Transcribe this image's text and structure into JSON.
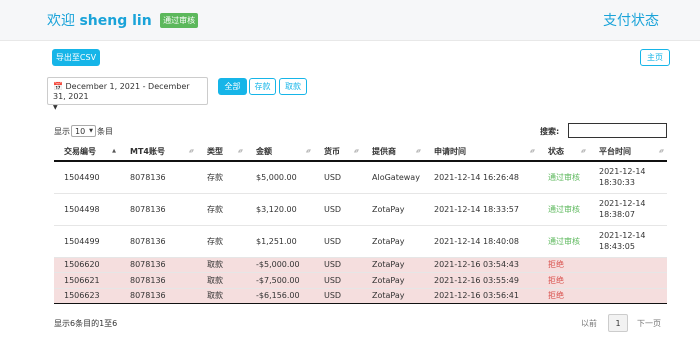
{
  "header": {
    "welcome": "欢迎",
    "username": "sheng lin",
    "verified_badge": "通过审核",
    "page_title": "支付状态"
  },
  "toolbar": {
    "export_label": "导出至CSV",
    "home_label": "主页"
  },
  "filters": {
    "date_range": "December 1, 2021 - December 31, 2021",
    "all_label": "全部",
    "deposit_label": "存款",
    "withdraw_label": "取款"
  },
  "table_controls": {
    "show_prefix": "显示",
    "page_size": "10",
    "show_suffix": "条目",
    "search_label": "搜索:",
    "search_value": ""
  },
  "table": {
    "columns": [
      "交易编号",
      "MT4账号",
      "类型",
      "金额",
      "货币",
      "提供商",
      "申请时间",
      "状态",
      "平台时间"
    ],
    "rows": [
      {
        "id": "1504490",
        "account": "8078136",
        "type": "存款",
        "amount": "$5,000.00",
        "currency": "USD",
        "provider": "AloGateway",
        "request_time": "2021-12-14 16:26:48",
        "status": "通过审核",
        "platform_date": "2021-12-14",
        "platform_time": "18:30:33"
      },
      {
        "id": "1504498",
        "account": "8078136",
        "type": "存款",
        "amount": "$3,120.00",
        "currency": "USD",
        "provider": "ZotaPay",
        "request_time": "2021-12-14 18:33:57",
        "status": "通过审核",
        "platform_date": "2021-12-14",
        "platform_time": "18:38:07"
      },
      {
        "id": "1504499",
        "account": "8078136",
        "type": "存款",
        "amount": "$1,251.00",
        "currency": "USD",
        "provider": "ZotaPay",
        "request_time": "2021-12-14 18:40:08",
        "status": "通过审核",
        "platform_date": "2021-12-14",
        "platform_time": "18:43:05"
      },
      {
        "id": "1506620",
        "account": "8078136",
        "type": "取款",
        "amount": "-$5,000.00",
        "currency": "USD",
        "provider": "ZotaPay",
        "request_time": "2021-12-16 03:54:43",
        "status": "拒绝",
        "platform_date": "",
        "platform_time": ""
      },
      {
        "id": "1506621",
        "account": "8078136",
        "type": "取款",
        "amount": "-$7,500.00",
        "currency": "USD",
        "provider": "ZotaPay",
        "request_time": "2021-12-16 03:55:49",
        "status": "拒绝",
        "platform_date": "",
        "platform_time": ""
      },
      {
        "id": "1506623",
        "account": "8078136",
        "type": "取款",
        "amount": "-$6,156.00",
        "currency": "USD",
        "provider": "ZotaPay",
        "request_time": "2021-12-16 03:56:41",
        "status": "拒绝",
        "platform_date": "",
        "platform_time": ""
      }
    ]
  },
  "footer": {
    "info": "显示6条目的1至6",
    "prev_label": "以前",
    "current_page": "1",
    "next_label": "下一页"
  },
  "colors": {
    "accent": "#16b5e8",
    "approved": "#5cb85c",
    "rejected": "#d9534f",
    "rejected_row_bg": "#f5dede"
  }
}
